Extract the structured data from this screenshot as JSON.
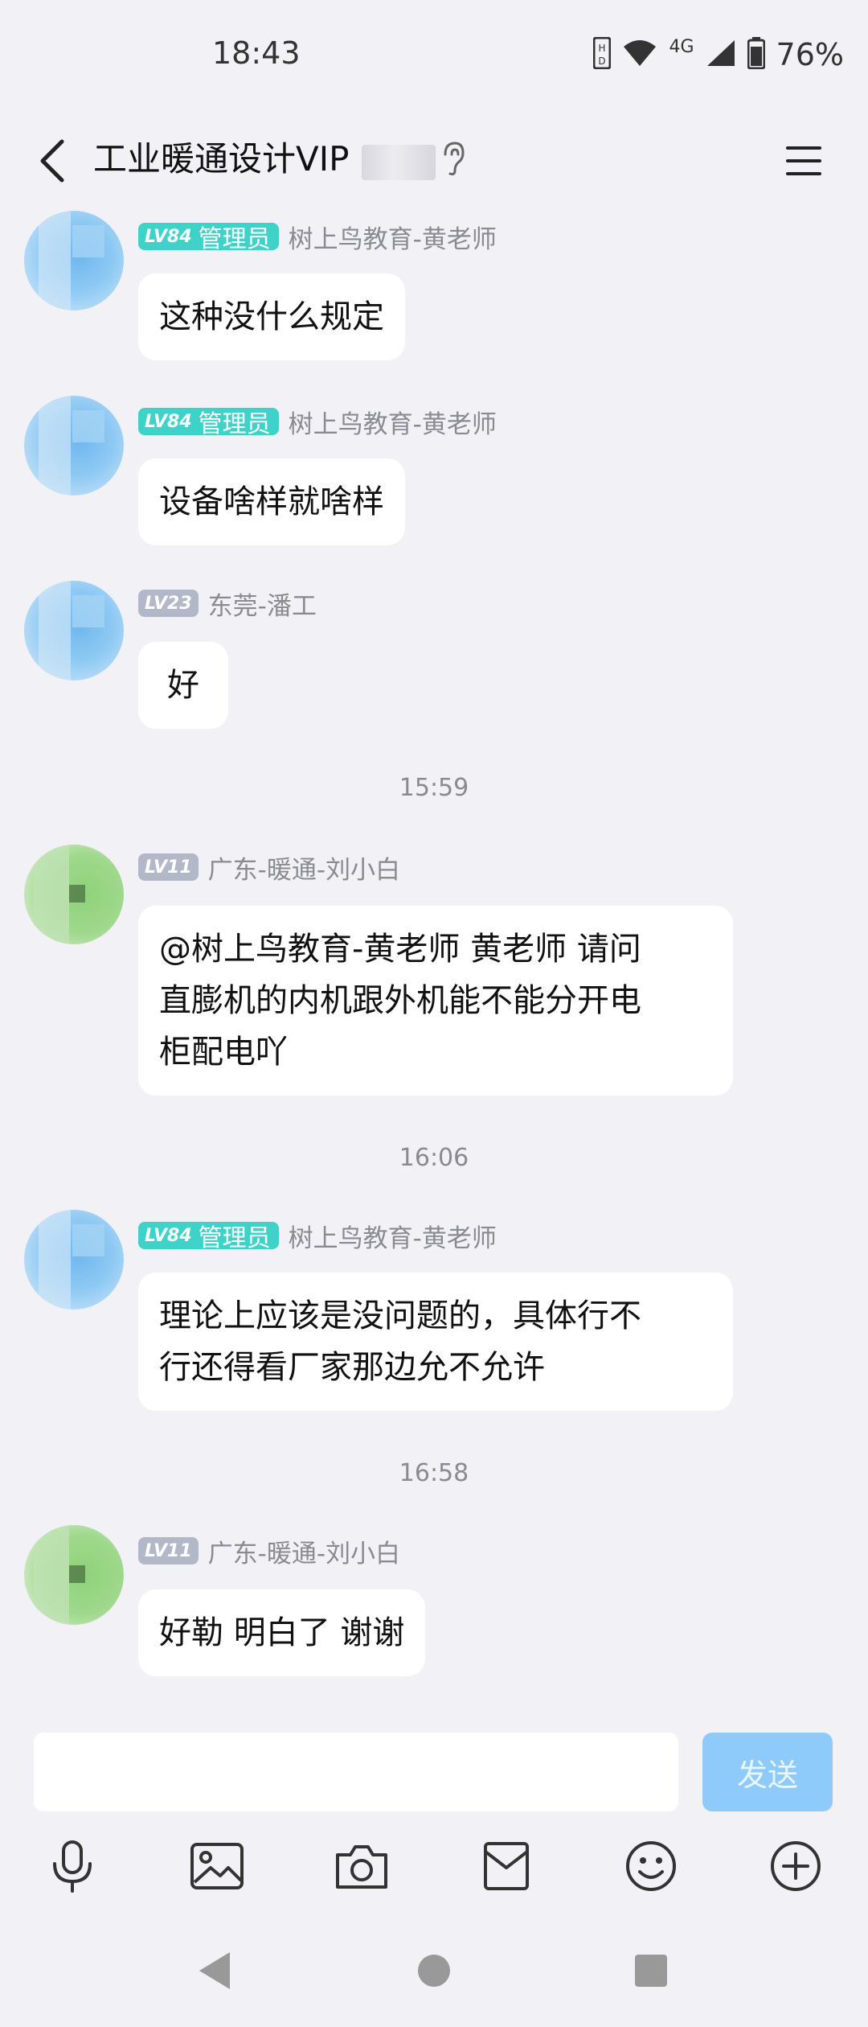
{
  "status": {
    "time": "18:43",
    "battery": "76%",
    "network": "4G"
  },
  "header": {
    "title": "工业暖通设计VIP"
  },
  "messages": [
    {
      "lv": "LV84",
      "role": "管理员",
      "sender": "树上鸟教育-黄老师",
      "text": "这种没什么规定"
    },
    {
      "lv": "LV84",
      "role": "管理员",
      "sender": "树上鸟教育-黄老师",
      "text": "设备啥样就啥样"
    },
    {
      "lv": "LV23",
      "sender": "东莞-潘工",
      "text": "好"
    },
    {
      "time": "15:59"
    },
    {
      "lv": "LV11",
      "sender": "广东-暖通-刘小白",
      "lines": [
        "@树上鸟教育-黄老师 黄老师 请问",
        "直膨机的内机跟外机能不能分开电",
        "柜配电吖"
      ]
    },
    {
      "time": "16:06"
    },
    {
      "lv": "LV84",
      "role": "管理员",
      "sender": "树上鸟教育-黄老师",
      "lines": [
        "理论上应该是没问题的，具体行不",
        "行还得看厂家那边允不允许"
      ]
    },
    {
      "time": "16:58"
    },
    {
      "lv": "LV11",
      "sender": "广东-暖通-刘小白",
      "text": "好勒 明白了 谢谢"
    }
  ],
  "input": {
    "value": "",
    "send_label": "发送"
  },
  "toolbar": [
    "microphone-icon",
    "image-icon",
    "camera-icon",
    "envelope-icon",
    "emoji-icon",
    "plus-icon"
  ],
  "colors": {
    "background": "#f1f1f6",
    "admin_badge": "#3fd2c8",
    "level_badge": "#b3b8c8",
    "send_button": "#8ecbfa"
  }
}
